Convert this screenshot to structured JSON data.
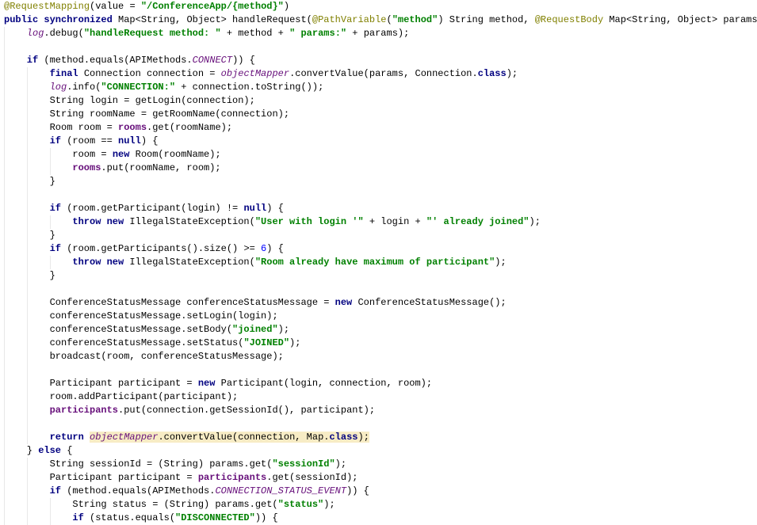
{
  "editor": {
    "lines": [
      {
        "indent": 0,
        "tokens": [
          [
            "a",
            "@RequestMapping"
          ],
          [
            "p",
            "(value = "
          ],
          [
            "s",
            "\"/ConferenceApp/{method}\""
          ],
          [
            "p",
            ")"
          ]
        ]
      },
      {
        "indent": 0,
        "tokens": [
          [
            "k",
            "public synchronized "
          ],
          [
            "p",
            "Map<String, Object> handleRequest("
          ],
          [
            "a",
            "@PathVariable"
          ],
          [
            "p",
            "("
          ],
          [
            "s",
            "\"method\""
          ],
          [
            "p",
            ") String method, "
          ],
          [
            "a",
            "@RequestBody"
          ],
          [
            "p",
            " Map<String, Object> params) {"
          ]
        ]
      },
      {
        "indent": 1,
        "tokens": [
          [
            "si",
            "log"
          ],
          [
            "p",
            ".debug("
          ],
          [
            "s",
            "\"handleRequest method: \""
          ],
          [
            "p",
            " + method + "
          ],
          [
            "s",
            "\" params:\""
          ],
          [
            "p",
            " + params);"
          ]
        ]
      },
      {
        "indent": 1,
        "tokens": []
      },
      {
        "indent": 1,
        "tokens": [
          [
            "k",
            "if"
          ],
          [
            "p",
            " (method.equals(APIMethods."
          ],
          [
            "si",
            "CONNECT"
          ],
          [
            "p",
            ")) {"
          ]
        ]
      },
      {
        "indent": 2,
        "tokens": [
          [
            "k",
            "final "
          ],
          [
            "p",
            "Connection connection = "
          ],
          [
            "si",
            "objectMapper"
          ],
          [
            "p",
            ".convertValue(params, Connection."
          ],
          [
            "k",
            "class"
          ],
          [
            "p",
            ");"
          ]
        ]
      },
      {
        "indent": 2,
        "tokens": [
          [
            "si",
            "log"
          ],
          [
            "p",
            ".info("
          ],
          [
            "s",
            "\"CONNECTION:\""
          ],
          [
            "p",
            " + connection.toString());"
          ]
        ]
      },
      {
        "indent": 2,
        "tokens": [
          [
            "p",
            "String login = getLogin(connection);"
          ]
        ]
      },
      {
        "indent": 2,
        "tokens": [
          [
            "p",
            "String roomName = getRoomName(connection);"
          ]
        ]
      },
      {
        "indent": 2,
        "tokens": [
          [
            "p",
            "Room room = "
          ],
          [
            "f",
            "rooms"
          ],
          [
            "p",
            ".get(roomName);"
          ]
        ]
      },
      {
        "indent": 2,
        "tokens": [
          [
            "k",
            "if"
          ],
          [
            "p",
            " (room == "
          ],
          [
            "k",
            "null"
          ],
          [
            "p",
            ") {"
          ]
        ]
      },
      {
        "indent": 3,
        "tokens": [
          [
            "p",
            "room = "
          ],
          [
            "k",
            "new "
          ],
          [
            "p",
            "Room(roomName);"
          ]
        ]
      },
      {
        "indent": 3,
        "tokens": [
          [
            "f",
            "rooms"
          ],
          [
            "p",
            ".put(roomName, room);"
          ]
        ]
      },
      {
        "indent": 2,
        "tokens": [
          [
            "p",
            "}"
          ]
        ]
      },
      {
        "indent": 2,
        "tokens": []
      },
      {
        "indent": 2,
        "tokens": [
          [
            "k",
            "if"
          ],
          [
            "p",
            " (room.getParticipant(login) != "
          ],
          [
            "k",
            "null"
          ],
          [
            "p",
            ") {"
          ]
        ]
      },
      {
        "indent": 3,
        "tokens": [
          [
            "k",
            "throw new "
          ],
          [
            "p",
            "IllegalStateException("
          ],
          [
            "s",
            "\"User with login '\""
          ],
          [
            "p",
            " + login + "
          ],
          [
            "s",
            "\"' already joined\""
          ],
          [
            "p",
            ");"
          ]
        ]
      },
      {
        "indent": 2,
        "tokens": [
          [
            "p",
            "}"
          ]
        ]
      },
      {
        "indent": 2,
        "tokens": [
          [
            "k",
            "if"
          ],
          [
            "p",
            " (room.getParticipants().size() >= "
          ],
          [
            "n",
            "6"
          ],
          [
            "p",
            ") {"
          ]
        ]
      },
      {
        "indent": 3,
        "tokens": [
          [
            "k",
            "throw new "
          ],
          [
            "p",
            "IllegalStateException("
          ],
          [
            "s",
            "\"Room already have maximum of participant\""
          ],
          [
            "p",
            ");"
          ]
        ]
      },
      {
        "indent": 2,
        "tokens": [
          [
            "p",
            "}"
          ]
        ]
      },
      {
        "indent": 2,
        "tokens": []
      },
      {
        "indent": 2,
        "tokens": [
          [
            "p",
            "ConferenceStatusMessage conferenceStatusMessage = "
          ],
          [
            "k",
            "new "
          ],
          [
            "p",
            "ConferenceStatusMessage();"
          ]
        ]
      },
      {
        "indent": 2,
        "tokens": [
          [
            "p",
            "conferenceStatusMessage.setLogin(login);"
          ]
        ]
      },
      {
        "indent": 2,
        "tokens": [
          [
            "p",
            "conferenceStatusMessage.setBody("
          ],
          [
            "s",
            "\"joined\""
          ],
          [
            "p",
            ");"
          ]
        ]
      },
      {
        "indent": 2,
        "tokens": [
          [
            "p",
            "conferenceStatusMessage.setStatus("
          ],
          [
            "s",
            "\"JOINED\""
          ],
          [
            "p",
            ");"
          ]
        ]
      },
      {
        "indent": 2,
        "tokens": [
          [
            "p",
            "broadcast(room, conferenceStatusMessage);"
          ]
        ]
      },
      {
        "indent": 2,
        "tokens": []
      },
      {
        "indent": 2,
        "tokens": [
          [
            "p",
            "Participant participant = "
          ],
          [
            "k",
            "new "
          ],
          [
            "p",
            "Participant(login, connection, room);"
          ]
        ]
      },
      {
        "indent": 2,
        "tokens": [
          [
            "p",
            "room.addParticipant(participant);"
          ]
        ]
      },
      {
        "indent": 2,
        "tokens": [
          [
            "f",
            "participants"
          ],
          [
            "p",
            ".put(connection.getSessionId(), participant);"
          ]
        ]
      },
      {
        "indent": 2,
        "tokens": []
      },
      {
        "indent": 2,
        "tokens": [
          [
            "k",
            "return "
          ],
          [
            "si",
            "objectMapper",
            1
          ],
          [
            "p",
            ".convertValue(connection, Map.",
            1
          ],
          [
            "k",
            "class",
            1
          ],
          [
            "p",
            ");",
            1
          ]
        ]
      },
      {
        "indent": 1,
        "tokens": [
          [
            "p",
            "} "
          ],
          [
            "k",
            "else"
          ],
          [
            "p",
            " {"
          ]
        ]
      },
      {
        "indent": 2,
        "tokens": [
          [
            "p",
            "String sessionId = (String) params.get("
          ],
          [
            "s",
            "\"sessionId\""
          ],
          [
            "p",
            ");"
          ]
        ]
      },
      {
        "indent": 2,
        "tokens": [
          [
            "p",
            "Participant participant = "
          ],
          [
            "f",
            "participants"
          ],
          [
            "p",
            ".get(sessionId);"
          ]
        ]
      },
      {
        "indent": 2,
        "tokens": [
          [
            "k",
            "if"
          ],
          [
            "p",
            " (method.equals(APIMethods."
          ],
          [
            "si",
            "CONNECTION_STATUS_EVENT"
          ],
          [
            "p",
            ")) {"
          ]
        ]
      },
      {
        "indent": 3,
        "tokens": [
          [
            "p",
            "String status = (String) params.get("
          ],
          [
            "s",
            "\"status\""
          ],
          [
            "p",
            ");"
          ]
        ]
      },
      {
        "indent": 3,
        "tokens": [
          [
            "k",
            "if"
          ],
          [
            "p",
            " (status.equals("
          ],
          [
            "s",
            "\"DISCONNECTED\""
          ],
          [
            "p",
            ")) {"
          ]
        ]
      }
    ]
  },
  "colors": {
    "keyword": "#000080",
    "string": "#008000",
    "annotation": "#808000",
    "field": "#660e7a",
    "number": "#0000ff",
    "highlight": "#f7ecc5",
    "indent_guide": "#e8e8e8"
  }
}
